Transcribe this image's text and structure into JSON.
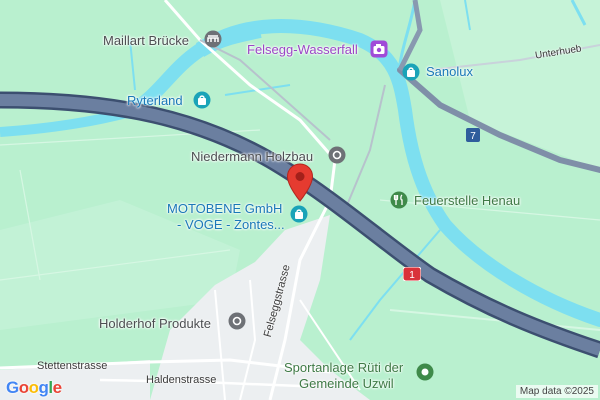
{
  "map": {
    "colors": {
      "land": "#b9f0cf",
      "water": "#7ddff0",
      "urban": "#eef0f2",
      "highway": "#6b7fa0",
      "highway_edge": "#3c4f70",
      "teal_poi": "#1aa3b8",
      "purple_poi": "#a04ad8",
      "green_poi": "#3f8a4a",
      "gray_poi": "#6e7176",
      "marker": "#e53b30"
    },
    "pois": [
      {
        "id": "maillart",
        "label": "Maillart Brücke",
        "icon": "bridge-icon",
        "color": "#4d4f52"
      },
      {
        "id": "felsegg",
        "label": "Felsegg-Wasserfall",
        "icon": "camera-icon",
        "color": "#9b46c6"
      },
      {
        "id": "sanolux",
        "label": "Sanolux",
        "icon": "shopping-bag-icon",
        "color": "#1a78b8"
      },
      {
        "id": "ryterland",
        "label": "Ryterland",
        "icon": "shopping-bag-icon",
        "color": "#1a78b8"
      },
      {
        "id": "niedermann",
        "label": "Niedermann Holzbau",
        "icon": "building-icon",
        "color": "#4d4f52"
      },
      {
        "id": "feuerstelle",
        "label": "Feuerstelle Henau",
        "icon": "restaurant-icon",
        "color": "#3f7a46"
      },
      {
        "id": "motobene",
        "label_line1": "MOTOBENE GmbH",
        "label_line2": "- VOGE - Zontes...",
        "icon": "shopping-bag-icon",
        "color": "#1a78b8"
      },
      {
        "id": "holderhof",
        "label": "Holderhof Produkte",
        "icon": "building-icon",
        "color": "#4d4f52"
      },
      {
        "id": "sportanlage",
        "label_line1": "Sportanlage Rüti der",
        "label_line2": "Gemeinde Uzwil",
        "icon": "park-icon",
        "color": "#3f7a46"
      }
    ],
    "streets": {
      "unterhueb": "Unterhueb",
      "felseggstrasse": "Felseggstrasse",
      "stettenstrasse": "Stettenstrasse",
      "haldenstrasse": "Haldenstrasse"
    },
    "route_shields": {
      "shield_7": "7",
      "shield_1": "1"
    },
    "footer": {
      "logo": "Google",
      "attribution": "Map data ©2025"
    }
  }
}
